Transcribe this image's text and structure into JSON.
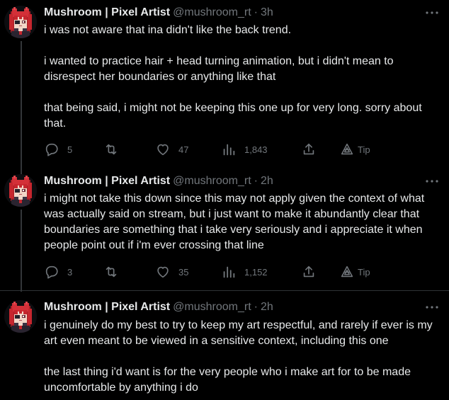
{
  "tweets": [
    {
      "display_name": "Mushroom | Pixel Artist",
      "handle": "@mushroom_rt",
      "separator": "·",
      "time": "3h",
      "paragraphs": [
        "i was not aware that ina didn't like the back trend.",
        "i wanted to practice hair + head turning animation, but i didn't mean to disrespect her boundaries or anything like that",
        "that being said, i might not be keeping this one up for very long. sorry about that."
      ],
      "replies": "5",
      "retweets": "",
      "likes": "47",
      "views": "1,843",
      "tip_label": "Tip"
    },
    {
      "display_name": "Mushroom | Pixel Artist",
      "handle": "@mushroom_rt",
      "separator": "·",
      "time": "2h",
      "paragraphs": [
        "i might not take this down since this may not apply given the context of what was actually said on stream, but i just want to make it abundantly clear that boundaries are something that i take very seriously and i appreciate it when people point out if i'm ever crossing that line"
      ],
      "replies": "3",
      "retweets": "",
      "likes": "35",
      "views": "1,152",
      "tip_label": "Tip"
    },
    {
      "display_name": "Mushroom | Pixel Artist",
      "handle": "@mushroom_rt",
      "separator": "·",
      "time": "2h",
      "paragraphs": [
        "i genuinely do my best to try to keep my art respectful, and rarely if ever is my art even meant to be viewed in a sensitive context, including this one",
        "the last thing i'd want is for the very people who i make art for to be made uncomfortable by anything i do"
      ]
    }
  ],
  "icons": {
    "reply": "reply-icon",
    "retweet": "retweet-icon",
    "like": "heart-icon",
    "views": "views-icon",
    "share": "share-icon",
    "tip": "tip-icon",
    "more": "more-icon",
    "avatar": "pixel-art-avatar"
  },
  "colors": {
    "background": "#000000",
    "text": "#e7e9ea",
    "muted": "#71767b",
    "divider": "#2f3336",
    "avatar_hair": "#c6262e"
  }
}
